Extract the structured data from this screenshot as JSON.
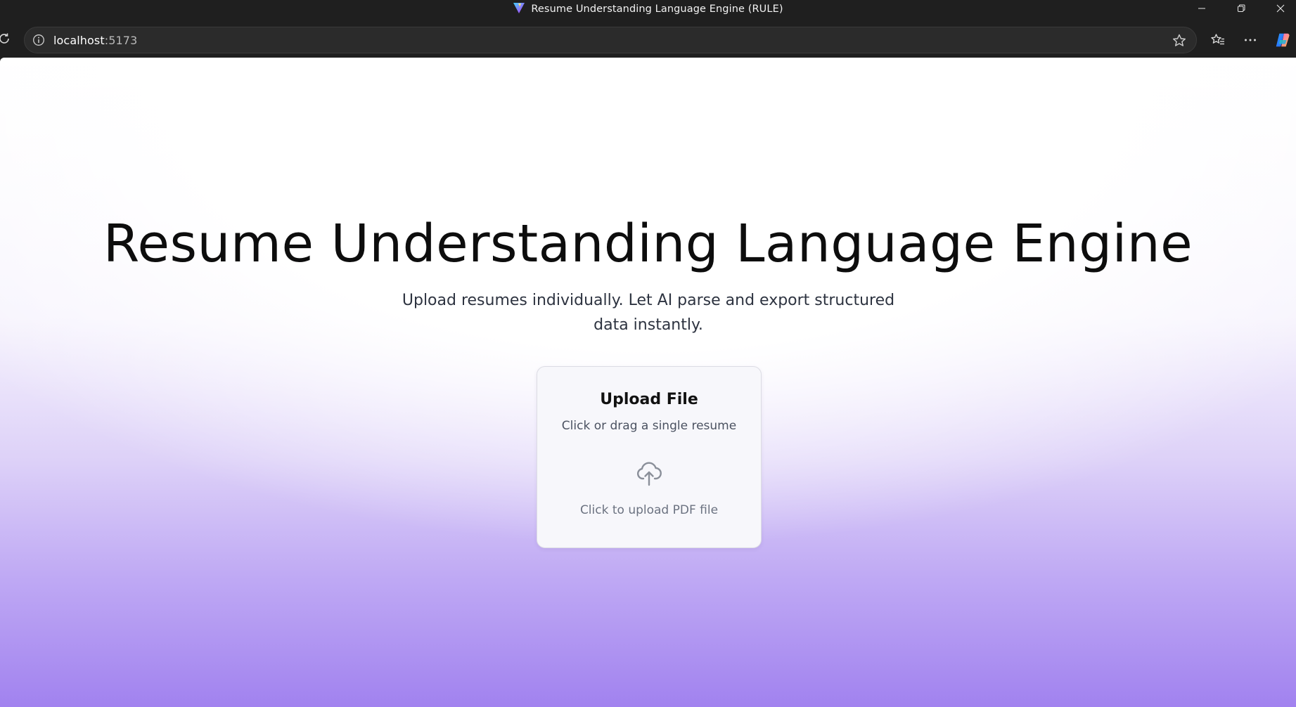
{
  "window": {
    "title": "Resume Understanding Language Engine (RULE)",
    "app_icon": "vite-logo-icon",
    "controls": [
      "minimize-icon",
      "restore-icon",
      "close-icon"
    ]
  },
  "browser": {
    "url_host": "localhost",
    "url_port": ":5173",
    "icons": {
      "reload": "reload-icon",
      "site_info": "info-icon",
      "favorite": "star-icon",
      "favorites_list": "favorites-icon",
      "more": "more-icon",
      "copilot": "copilot-icon"
    }
  },
  "page": {
    "title": "Resume Understanding Language Engine",
    "subtitle": "Upload resumes individually. Let AI parse and export structured data instantly.",
    "upload_card": {
      "title": "Upload File",
      "subtitle": "Click or drag a single resume",
      "drop_label": "Click to upload PDF file",
      "icon": "cloud-upload-icon"
    }
  },
  "colors": {
    "chrome": "#1f1f1f",
    "gradient_bottom": "#a182ef",
    "accent_purple": "#8b5cf6"
  }
}
